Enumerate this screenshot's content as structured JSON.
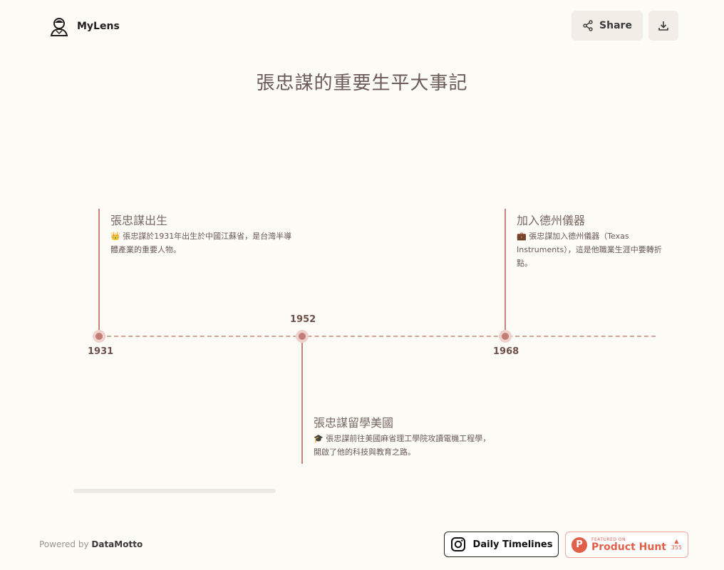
{
  "brand": {
    "name": "MyLens",
    "logo_icon": "person-lens-icon"
  },
  "toolbar": {
    "share_label": "Share",
    "share_icon": "share-icon",
    "download_icon": "download-icon"
  },
  "title": "張忠謀的重要生平大事記",
  "events": [
    {
      "year": "1931",
      "title": "張忠謀出生",
      "description": "👑 張忠謀於1931年出生於中國江蘇省，是台灣半導體產業的重要人物。"
    },
    {
      "year": "1952",
      "title": "張忠謀留學美國",
      "description": "🎓 張忠謀前往美國麻省理工學院攻讀電機工程學，開啟了他的科技與教育之路。"
    },
    {
      "year": "1968",
      "title": "加入德州儀器",
      "description": "💼 張忠謀加入德州儀器（Texas Instruments），這是他職業生涯中要轉折點。"
    }
  ],
  "footer": {
    "powered_prefix": "Powered by",
    "powered_brand": "DataMotto",
    "daily_timelines": "Daily Timelines",
    "product_hunt": {
      "small": "FEATURED ON",
      "name": "Product Hunt",
      "votes": "355"
    }
  },
  "colors": {
    "accent": "#c47c76",
    "background": "#fdfbf6",
    "product_hunt": "#e0604a"
  }
}
